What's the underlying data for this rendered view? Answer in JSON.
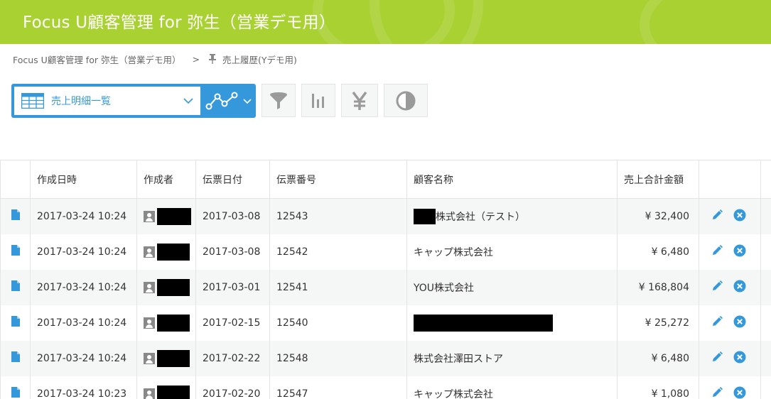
{
  "header": {
    "title": "Focus U顧客管理 for 弥生（営業デモ用）",
    "background": "#a9d131"
  },
  "breadcrumb": {
    "app_link": "Focus U顧客管理 for 弥生（営業デモ用）",
    "separator": ">",
    "current": "売上履歴(Yデモ用)"
  },
  "toolbar": {
    "view_label": "売上明細一覧",
    "view_icon": "table-icon",
    "graph_icon": "line-graph-icon",
    "buttons": [
      {
        "name": "filter-button",
        "icon": "funnel-icon"
      },
      {
        "name": "summary-button",
        "icon": "bar-chart-icon"
      },
      {
        "name": "yen-button",
        "icon": "yen-icon"
      },
      {
        "name": "contrast-button",
        "icon": "half-circle-icon"
      }
    ],
    "accent": "#3498db"
  },
  "table": {
    "columns": [
      "作成日時",
      "作成者",
      "伝票日付",
      "伝票番号",
      "顧客名称",
      "売上合計金額"
    ],
    "rows": [
      {
        "created_at": "2017-03-24 10:24",
        "slip_date": "2017-03-08",
        "slip_no": "12543",
        "customer": "株式会社（テスト）",
        "amount": "¥ 32,400"
      },
      {
        "created_at": "2017-03-24 10:24",
        "slip_date": "2017-03-08",
        "slip_no": "12542",
        "customer": "キャップ株式会社",
        "amount": "¥ 6,480"
      },
      {
        "created_at": "2017-03-24 10:24",
        "slip_date": "2017-03-01",
        "slip_no": "12541",
        "customer": "YOU株式会社",
        "amount": "¥ 168,804"
      },
      {
        "created_at": "2017-03-24 10:24",
        "slip_date": "2017-02-15",
        "slip_no": "12540",
        "customer": "",
        "amount": "¥ 25,272"
      },
      {
        "created_at": "2017-03-24 10:24",
        "slip_date": "2017-02-22",
        "slip_no": "12548",
        "customer": "株式会社澤田ストア",
        "amount": "¥ 6,480"
      },
      {
        "created_at": "2017-03-24 10:23",
        "slip_date": "2017-02-20",
        "slip_no": "12547",
        "customer": "キャップ株式会社",
        "amount": "¥ 1,080"
      }
    ],
    "row_icons": {
      "record": "document-icon",
      "creator": "user-icon",
      "edit": "pencil-icon",
      "delete": "close-circle-icon"
    },
    "colors": {
      "stripe": "#f5f6f6",
      "border": "#e3e4e4",
      "icon_blue": "#3498db"
    }
  }
}
